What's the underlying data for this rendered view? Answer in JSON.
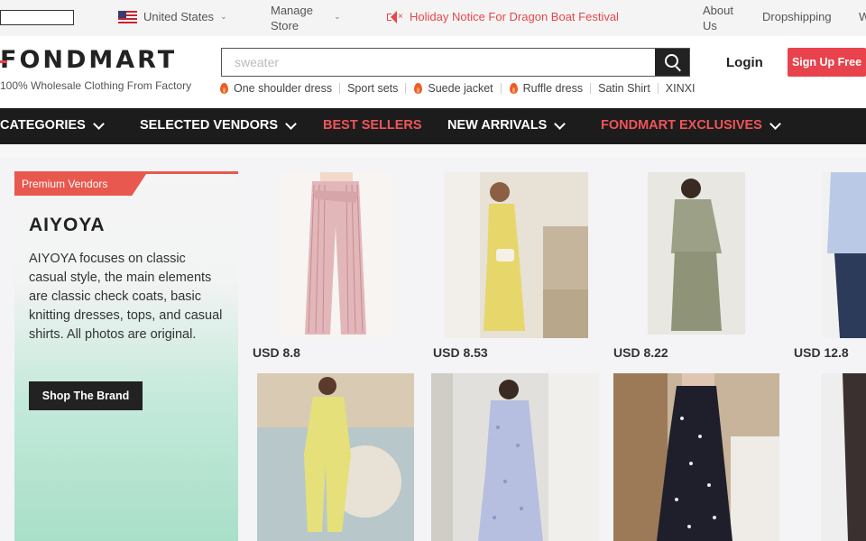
{
  "topbar": {
    "country": "United States",
    "manage_store": "Manage\nStore",
    "holiday_notice": "Holiday Notice For Dragon Boat Festival",
    "about_us": "About\nUs",
    "dropshipping": "Dropshipping",
    "extra": "W"
  },
  "header": {
    "logo": "FONDMART",
    "tagline": "100% Wholesale Clothing From Factory",
    "search_placeholder": "sweater",
    "hot_searches": [
      {
        "label": "One shoulder dress",
        "hot": true
      },
      {
        "label": "Sport sets",
        "hot": false
      },
      {
        "label": "Suede jacket",
        "hot": true
      },
      {
        "label": "Ruffle dress",
        "hot": true
      },
      {
        "label": "Satin Shirt",
        "hot": false
      },
      {
        "label": "XINXI",
        "hot": false
      }
    ],
    "login": "Login",
    "signup": "Sign Up Free"
  },
  "nav": {
    "categories": "CATEGORIES",
    "selected_vendors": "SELECTED VENDORS",
    "best_sellers": "BEST SELLERS",
    "new_arrivals": "NEW ARRIVALS",
    "exclusives": "FONDMART EXCLUSIVES"
  },
  "promo": {
    "badge": "Premium Vendors",
    "brand": "AIYOYA",
    "description": "AIYOYA focuses on classic casual style, the main elements are classic check coats, basic knitting dresses, tops, and casual shirts. All photos are original.",
    "button": "Shop The Brand"
  },
  "products": [
    {
      "price": "USD 8.8"
    },
    {
      "price": "USD 8.53"
    },
    {
      "price": "USD 8.22"
    },
    {
      "price": "USD 12.8"
    },
    {
      "price": ""
    },
    {
      "price": ""
    },
    {
      "price": ""
    },
    {
      "price": ""
    }
  ],
  "colors": {
    "accent": "#e8434c",
    "nav_bg": "#1c1c1c",
    "nav_highlight": "#f0545a"
  }
}
